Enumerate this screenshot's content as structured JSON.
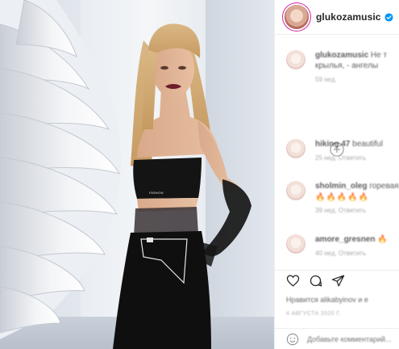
{
  "post": {
    "username": "glukozamusic",
    "verified_icon": "verified-badge-icon",
    "accent_color": "#0095f6"
  },
  "comments": [
    {
      "user": "glukozamusic",
      "text": "Не т",
      "line2": "крылья, - ангелы",
      "meta": "59 нед."
    },
    {
      "user": "hiking.47",
      "text": "beautiful",
      "meta": "25 нед.   Ответить"
    },
    {
      "user": "sholmin_oleg",
      "text": "горевая",
      "emojis": "🔥🔥🔥🔥🔥",
      "meta": "39 нед.   Ответить"
    },
    {
      "user": "amore_gresnen",
      "text": "🔥",
      "meta": "40 нед.   Ответить"
    }
  ],
  "likes_text": "Нравится alikabyinov и е",
  "timestamp": "4 АВГУСТА 2020 Г.",
  "add_comment_placeholder": "Добавьте комментарий..."
}
